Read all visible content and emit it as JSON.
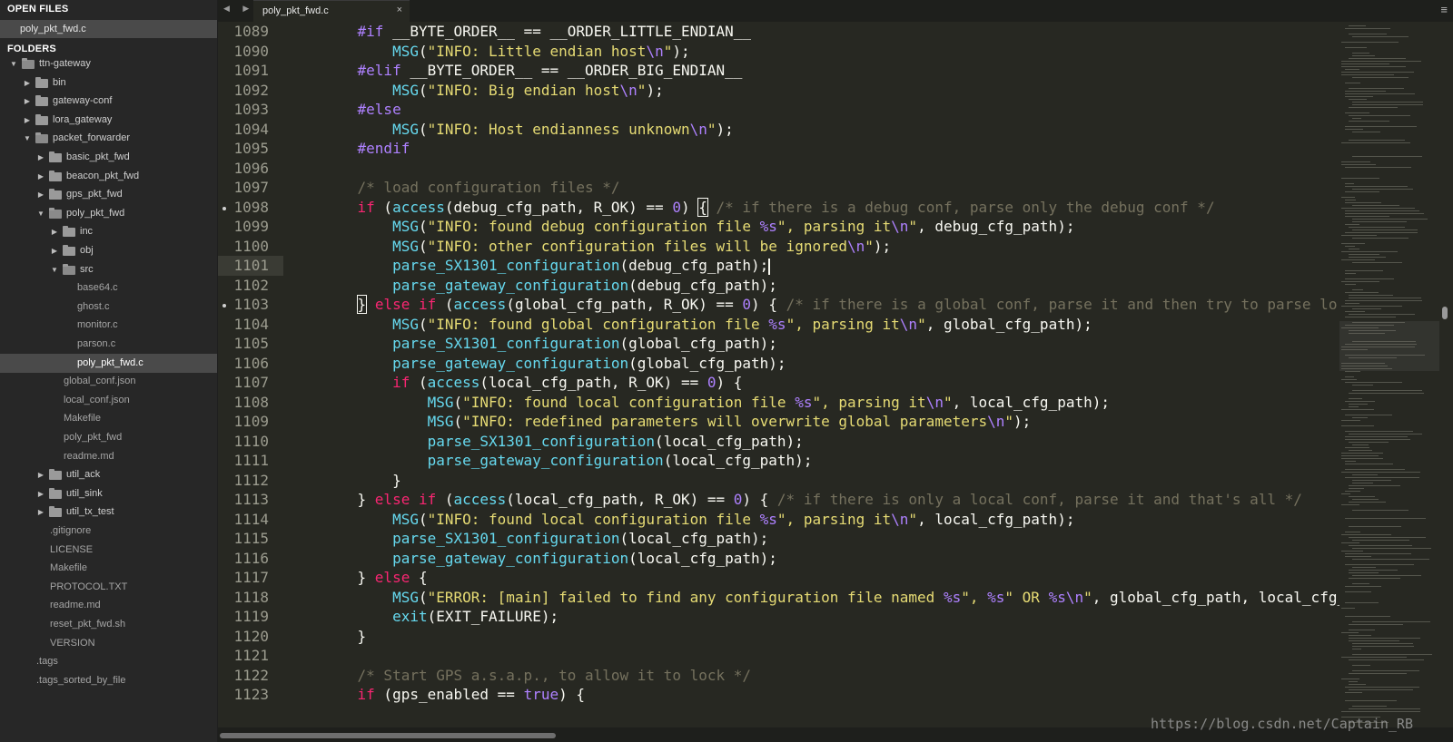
{
  "sidebar": {
    "open_files_header": "OPEN FILES",
    "open_file": "poly_pkt_fwd.c",
    "folders_header": "FOLDERS",
    "tree": [
      {
        "label": "ttn-gateway",
        "depth": 0,
        "type": "folder",
        "open": true
      },
      {
        "label": "bin",
        "depth": 1,
        "type": "folder",
        "open": false
      },
      {
        "label": "gateway-conf",
        "depth": 1,
        "type": "folder",
        "open": false
      },
      {
        "label": "lora_gateway",
        "depth": 1,
        "type": "folder",
        "open": false
      },
      {
        "label": "packet_forwarder",
        "depth": 1,
        "type": "folder",
        "open": true
      },
      {
        "label": "basic_pkt_fwd",
        "depth": 2,
        "type": "folder",
        "open": false
      },
      {
        "label": "beacon_pkt_fwd",
        "depth": 2,
        "type": "folder",
        "open": false
      },
      {
        "label": "gps_pkt_fwd",
        "depth": 2,
        "type": "folder",
        "open": false
      },
      {
        "label": "poly_pkt_fwd",
        "depth": 2,
        "type": "folder",
        "open": true
      },
      {
        "label": "inc",
        "depth": 3,
        "type": "folder",
        "open": false
      },
      {
        "label": "obj",
        "depth": 3,
        "type": "folder",
        "open": false
      },
      {
        "label": "src",
        "depth": 3,
        "type": "folder",
        "open": true
      },
      {
        "label": "base64.c",
        "depth": 4,
        "type": "file"
      },
      {
        "label": "ghost.c",
        "depth": 4,
        "type": "file"
      },
      {
        "label": "monitor.c",
        "depth": 4,
        "type": "file"
      },
      {
        "label": "parson.c",
        "depth": 4,
        "type": "file"
      },
      {
        "label": "poly_pkt_fwd.c",
        "depth": 4,
        "type": "file",
        "selected": true
      },
      {
        "label": "global_conf.json",
        "depth": 3,
        "type": "file"
      },
      {
        "label": "local_conf.json",
        "depth": 3,
        "type": "file"
      },
      {
        "label": "Makefile",
        "depth": 3,
        "type": "file"
      },
      {
        "label": "poly_pkt_fwd",
        "depth": 3,
        "type": "file"
      },
      {
        "label": "readme.md",
        "depth": 3,
        "type": "file"
      },
      {
        "label": "util_ack",
        "depth": 2,
        "type": "folder",
        "open": false
      },
      {
        "label": "util_sink",
        "depth": 2,
        "type": "folder",
        "open": false
      },
      {
        "label": "util_tx_test",
        "depth": 2,
        "type": "folder",
        "open": false
      },
      {
        "label": ".gitignore",
        "depth": 2,
        "type": "file"
      },
      {
        "label": "LICENSE",
        "depth": 2,
        "type": "file"
      },
      {
        "label": "Makefile",
        "depth": 2,
        "type": "file"
      },
      {
        "label": "PROTOCOL.TXT",
        "depth": 2,
        "type": "file"
      },
      {
        "label": "readme.md",
        "depth": 2,
        "type": "file"
      },
      {
        "label": "reset_pkt_fwd.sh",
        "depth": 2,
        "type": "file"
      },
      {
        "label": "VERSION",
        "depth": 2,
        "type": "file"
      },
      {
        "label": ".tags",
        "depth": 1,
        "type": "file"
      },
      {
        "label": ".tags_sorted_by_file",
        "depth": 1,
        "type": "file"
      }
    ]
  },
  "tabbar": {
    "nav_arrows": "◀ ▶",
    "active_tab": "poly_pkt_fwd.c",
    "close_glyph": "×",
    "menu_glyph": "≡"
  },
  "editor": {
    "current_line": 1101,
    "lines": [
      {
        "n": "1089",
        "t": [
          [
            "    ",
            "txt"
          ],
          [
            "#if",
            "pp"
          ],
          [
            " __BYTE_ORDER__ == __ORDER_LITTLE_ENDIAN__",
            "txt"
          ]
        ]
      },
      {
        "n": "1090",
        "t": [
          [
            "        ",
            "txt"
          ],
          [
            "MSG",
            "fn"
          ],
          [
            "(",
            "txt"
          ],
          [
            "\"INFO: Little endian host",
            "str"
          ],
          [
            "\\n",
            "esc"
          ],
          [
            "\"",
            "str"
          ],
          [
            ");",
            "txt"
          ]
        ]
      },
      {
        "n": "1091",
        "t": [
          [
            "    ",
            "txt"
          ],
          [
            "#elif",
            "pp"
          ],
          [
            " __BYTE_ORDER__ == __ORDER_BIG_ENDIAN__",
            "txt"
          ]
        ]
      },
      {
        "n": "1092",
        "t": [
          [
            "        ",
            "txt"
          ],
          [
            "MSG",
            "fn"
          ],
          [
            "(",
            "txt"
          ],
          [
            "\"INFO: Big endian host",
            "str"
          ],
          [
            "\\n",
            "esc"
          ],
          [
            "\"",
            "str"
          ],
          [
            ");",
            "txt"
          ]
        ]
      },
      {
        "n": "1093",
        "t": [
          [
            "    ",
            "txt"
          ],
          [
            "#else",
            "pp"
          ]
        ]
      },
      {
        "n": "1094",
        "t": [
          [
            "        ",
            "txt"
          ],
          [
            "MSG",
            "fn"
          ],
          [
            "(",
            "txt"
          ],
          [
            "\"INFO: Host endianness unknown",
            "str"
          ],
          [
            "\\n",
            "esc"
          ],
          [
            "\"",
            "str"
          ],
          [
            ");",
            "txt"
          ]
        ]
      },
      {
        "n": "1095",
        "t": [
          [
            "    ",
            "txt"
          ],
          [
            "#endif",
            "pp"
          ]
        ]
      },
      {
        "n": "1096",
        "t": []
      },
      {
        "n": "1097",
        "t": [
          [
            "    ",
            "txt"
          ],
          [
            "/* load configuration files */",
            "cm"
          ]
        ]
      },
      {
        "n": "1098",
        "dot": true,
        "t": [
          [
            "    ",
            "txt"
          ],
          [
            "if",
            "kw"
          ],
          [
            " (",
            "txt"
          ],
          [
            "access",
            "fn"
          ],
          [
            "(debug_cfg_path, R_OK) == ",
            "txt"
          ],
          [
            "0",
            "num"
          ],
          [
            ") ",
            "txt"
          ],
          [
            "{",
            "brkt"
          ],
          [
            " ",
            "txt"
          ],
          [
            "/* if there is a debug conf, parse only the debug conf */",
            "cm"
          ]
        ]
      },
      {
        "n": "1099",
        "t": [
          [
            "        ",
            "txt"
          ],
          [
            "MSG",
            "fn"
          ],
          [
            "(",
            "txt"
          ],
          [
            "\"INFO: found debug configuration file ",
            "str"
          ],
          [
            "%s",
            "esc"
          ],
          [
            "\", parsing it",
            "str"
          ],
          [
            "\\n",
            "esc"
          ],
          [
            "\"",
            "str"
          ],
          [
            ", debug_cfg_path);",
            "txt"
          ]
        ]
      },
      {
        "n": "1100",
        "t": [
          [
            "        ",
            "txt"
          ],
          [
            "MSG",
            "fn"
          ],
          [
            "(",
            "txt"
          ],
          [
            "\"INFO: other configuration files will be ignored",
            "str"
          ],
          [
            "\\n",
            "esc"
          ],
          [
            "\"",
            "str"
          ],
          [
            ");",
            "txt"
          ]
        ]
      },
      {
        "n": "1101",
        "caret": true,
        "t": [
          [
            "        ",
            "txt"
          ],
          [
            "parse_SX1301_configuration",
            "fn"
          ],
          [
            "(debug_cfg_path);",
            "txt"
          ]
        ]
      },
      {
        "n": "1102",
        "t": [
          [
            "        ",
            "txt"
          ],
          [
            "parse_gateway_configuration",
            "fn"
          ],
          [
            "(debug_cfg_path);",
            "txt"
          ]
        ]
      },
      {
        "n": "1103",
        "dot": true,
        "t": [
          [
            "    ",
            "txt"
          ],
          [
            "}",
            "brkt"
          ],
          [
            " ",
            "txt"
          ],
          [
            "else if",
            "kw"
          ],
          [
            " (",
            "txt"
          ],
          [
            "access",
            "fn"
          ],
          [
            "(global_cfg_path, R_OK) == ",
            "txt"
          ],
          [
            "0",
            "num"
          ],
          [
            ") { ",
            "txt"
          ],
          [
            "/* if there is a global conf, parse it and then try to parse lo",
            "cm"
          ]
        ]
      },
      {
        "n": "1104",
        "t": [
          [
            "        ",
            "txt"
          ],
          [
            "MSG",
            "fn"
          ],
          [
            "(",
            "txt"
          ],
          [
            "\"INFO: found global configuration file ",
            "str"
          ],
          [
            "%s",
            "esc"
          ],
          [
            "\", parsing it",
            "str"
          ],
          [
            "\\n",
            "esc"
          ],
          [
            "\"",
            "str"
          ],
          [
            ", global_cfg_path);",
            "txt"
          ]
        ]
      },
      {
        "n": "1105",
        "t": [
          [
            "        ",
            "txt"
          ],
          [
            "parse_SX1301_configuration",
            "fn"
          ],
          [
            "(global_cfg_path);",
            "txt"
          ]
        ]
      },
      {
        "n": "1106",
        "t": [
          [
            "        ",
            "txt"
          ],
          [
            "parse_gateway_configuration",
            "fn"
          ],
          [
            "(global_cfg_path);",
            "txt"
          ]
        ]
      },
      {
        "n": "1107",
        "t": [
          [
            "        ",
            "txt"
          ],
          [
            "if",
            "kw"
          ],
          [
            " (",
            "txt"
          ],
          [
            "access",
            "fn"
          ],
          [
            "(local_cfg_path, R_OK) == ",
            "txt"
          ],
          [
            "0",
            "num"
          ],
          [
            ") {",
            "txt"
          ]
        ]
      },
      {
        "n": "1108",
        "t": [
          [
            "            ",
            "txt"
          ],
          [
            "MSG",
            "fn"
          ],
          [
            "(",
            "txt"
          ],
          [
            "\"INFO: found local configuration file ",
            "str"
          ],
          [
            "%s",
            "esc"
          ],
          [
            "\", parsing it",
            "str"
          ],
          [
            "\\n",
            "esc"
          ],
          [
            "\"",
            "str"
          ],
          [
            ", local_cfg_path);",
            "txt"
          ]
        ]
      },
      {
        "n": "1109",
        "t": [
          [
            "            ",
            "txt"
          ],
          [
            "MSG",
            "fn"
          ],
          [
            "(",
            "txt"
          ],
          [
            "\"INFO: redefined parameters will overwrite global parameters",
            "str"
          ],
          [
            "\\n",
            "esc"
          ],
          [
            "\"",
            "str"
          ],
          [
            ");",
            "txt"
          ]
        ]
      },
      {
        "n": "1110",
        "t": [
          [
            "            ",
            "txt"
          ],
          [
            "parse_SX1301_configuration",
            "fn"
          ],
          [
            "(local_cfg_path);",
            "txt"
          ]
        ]
      },
      {
        "n": "1111",
        "t": [
          [
            "            ",
            "txt"
          ],
          [
            "parse_gateway_configuration",
            "fn"
          ],
          [
            "(local_cfg_path);",
            "txt"
          ]
        ]
      },
      {
        "n": "1112",
        "t": [
          [
            "        }",
            "txt"
          ]
        ]
      },
      {
        "n": "1113",
        "t": [
          [
            "    } ",
            "txt"
          ],
          [
            "else if",
            "kw"
          ],
          [
            " (",
            "txt"
          ],
          [
            "access",
            "fn"
          ],
          [
            "(local_cfg_path, R_OK) == ",
            "txt"
          ],
          [
            "0",
            "num"
          ],
          [
            ") { ",
            "txt"
          ],
          [
            "/* if there is only a local conf, parse it and that's all */",
            "cm"
          ]
        ]
      },
      {
        "n": "1114",
        "t": [
          [
            "        ",
            "txt"
          ],
          [
            "MSG",
            "fn"
          ],
          [
            "(",
            "txt"
          ],
          [
            "\"INFO: found local configuration file ",
            "str"
          ],
          [
            "%s",
            "esc"
          ],
          [
            "\", parsing it",
            "str"
          ],
          [
            "\\n",
            "esc"
          ],
          [
            "\"",
            "str"
          ],
          [
            ", local_cfg_path);",
            "txt"
          ]
        ]
      },
      {
        "n": "1115",
        "t": [
          [
            "        ",
            "txt"
          ],
          [
            "parse_SX1301_configuration",
            "fn"
          ],
          [
            "(local_cfg_path);",
            "txt"
          ]
        ]
      },
      {
        "n": "1116",
        "t": [
          [
            "        ",
            "txt"
          ],
          [
            "parse_gateway_configuration",
            "fn"
          ],
          [
            "(local_cfg_path);",
            "txt"
          ]
        ]
      },
      {
        "n": "1117",
        "t": [
          [
            "    } ",
            "txt"
          ],
          [
            "else",
            "kw"
          ],
          [
            " {",
            "txt"
          ]
        ]
      },
      {
        "n": "1118",
        "t": [
          [
            "        ",
            "txt"
          ],
          [
            "MSG",
            "fn"
          ],
          [
            "(",
            "txt"
          ],
          [
            "\"ERROR: [main] failed to find any configuration file named ",
            "str"
          ],
          [
            "%s",
            "esc"
          ],
          [
            "\", ",
            "str"
          ],
          [
            "%s",
            "esc"
          ],
          [
            "\" OR ",
            "str"
          ],
          [
            "%s",
            "esc"
          ],
          [
            "\\n",
            "esc"
          ],
          [
            "\"",
            "str"
          ],
          [
            ", global_cfg_path, local_cfg_p",
            "txt"
          ]
        ]
      },
      {
        "n": "1119",
        "t": [
          [
            "        ",
            "txt"
          ],
          [
            "exit",
            "fn"
          ],
          [
            "(EXIT_FAILURE);",
            "txt"
          ]
        ]
      },
      {
        "n": "1120",
        "t": [
          [
            "    }",
            "txt"
          ]
        ]
      },
      {
        "n": "1121",
        "t": []
      },
      {
        "n": "1122",
        "t": [
          [
            "    ",
            "txt"
          ],
          [
            "/* Start GPS a.s.a.p., to allow it to lock */",
            "cm"
          ]
        ]
      },
      {
        "n": "1123",
        "t": [
          [
            "    ",
            "txt"
          ],
          [
            "if",
            "kw"
          ],
          [
            " (gps_enabled == ",
            "txt"
          ],
          [
            "true",
            "num"
          ],
          [
            ") {",
            "txt"
          ]
        ]
      }
    ]
  },
  "watermark": "https://blog.csdn.net/Captain_RB"
}
